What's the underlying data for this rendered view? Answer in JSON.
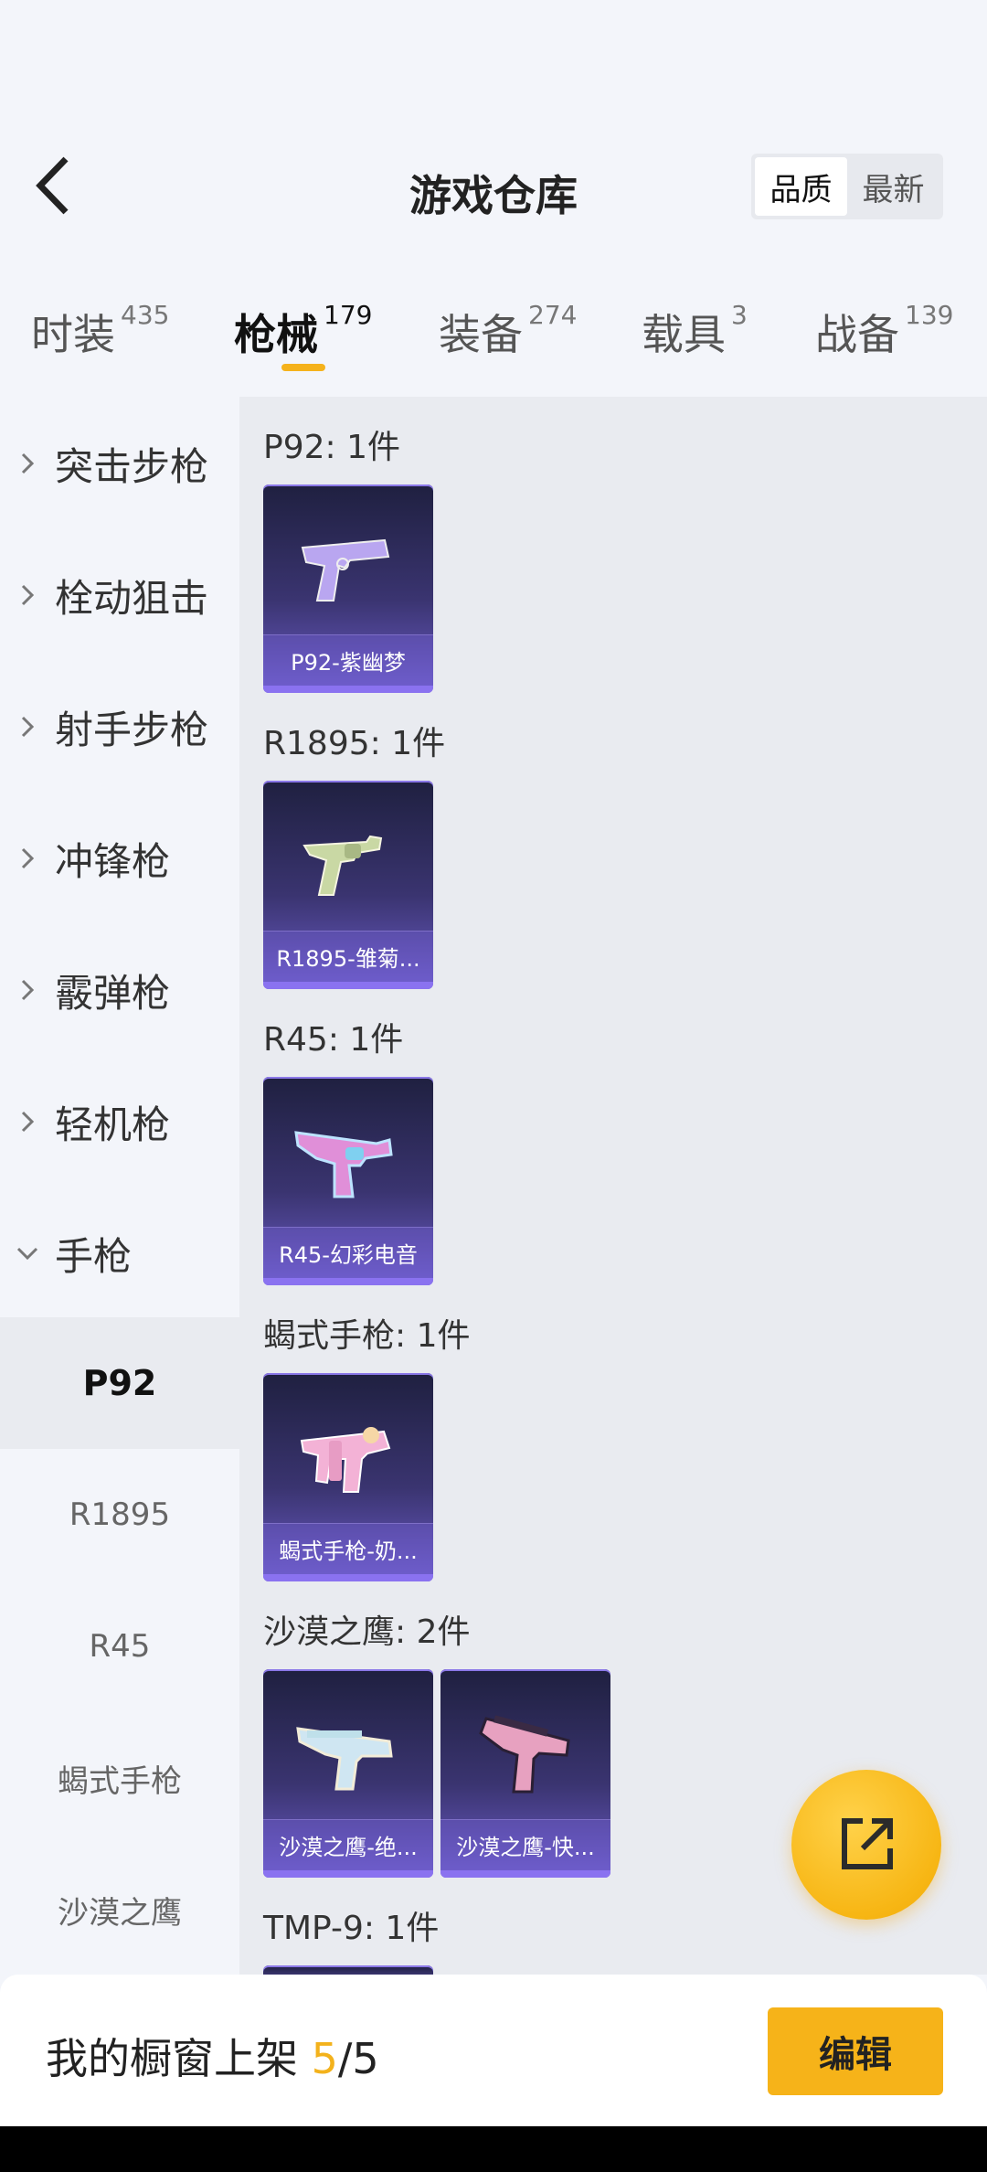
{
  "header": {
    "title": "游戏仓库",
    "sort_options": [
      "品质",
      "最新"
    ],
    "active_sort": "品质"
  },
  "tabs": [
    {
      "label": "时装",
      "count": "435",
      "active": false
    },
    {
      "label": "枪械",
      "count": "179",
      "active": true
    },
    {
      "label": "装备",
      "count": "274",
      "active": false
    },
    {
      "label": "载具",
      "count": "3",
      "active": false
    },
    {
      "label": "战备",
      "count": "139",
      "active": false
    }
  ],
  "sidebar": {
    "categories": [
      {
        "label": "突击步枪",
        "expanded": false
      },
      {
        "label": "栓动狙击",
        "expanded": false
      },
      {
        "label": "射手步枪",
        "expanded": false
      },
      {
        "label": "冲锋枪",
        "expanded": false
      },
      {
        "label": "霰弹枪",
        "expanded": false
      },
      {
        "label": "轻机枪",
        "expanded": false
      },
      {
        "label": "手枪",
        "expanded": true
      }
    ],
    "subitems": [
      {
        "label": "P92",
        "active": true
      },
      {
        "label": "R1895",
        "active": false
      },
      {
        "label": "R45",
        "active": false
      },
      {
        "label": "蝎式手枪",
        "active": false
      },
      {
        "label": "沙漠之鹰",
        "active": false
      }
    ]
  },
  "groups": [
    {
      "title": "P92: 1件",
      "items": [
        {
          "name": "P92-紫幽梦",
          "icon": "pistol-purple-icon",
          "color": "#b9a6f0"
        }
      ]
    },
    {
      "title": "R1895: 1件",
      "items": [
        {
          "name": "R1895-雏菊...",
          "icon": "revolver-icon",
          "color": "#c9d8a4"
        }
      ]
    },
    {
      "title": "R45: 1件",
      "items": [
        {
          "name": "R45-幻彩电音",
          "icon": "revolver-pink-icon",
          "color": "#e08fd8"
        }
      ]
    },
    {
      "title": "蝎式手枪: 1件",
      "items": [
        {
          "name": "蝎式手枪-奶...",
          "icon": "smg-pistol-icon",
          "color": "#f3b2d6"
        }
      ]
    },
    {
      "title": "沙漠之鹰: 2件",
      "items": [
        {
          "name": "沙漠之鹰-绝...",
          "icon": "deagle-icon",
          "color": "#cfe6f2"
        },
        {
          "name": "沙漠之鹰-快...",
          "icon": "deagle-pink-icon",
          "color": "#e7a1c0"
        }
      ]
    },
    {
      "title": "TMP-9: 1件",
      "items": []
    }
  ],
  "bottom_bar": {
    "prefix": "我的橱窗上架 ",
    "current": "5",
    "total": "/5",
    "edit_label": "编辑"
  },
  "colors": {
    "accent": "#f5b21b",
    "card_dark": "#1f2040",
    "card_light": "#6b5bc7"
  }
}
